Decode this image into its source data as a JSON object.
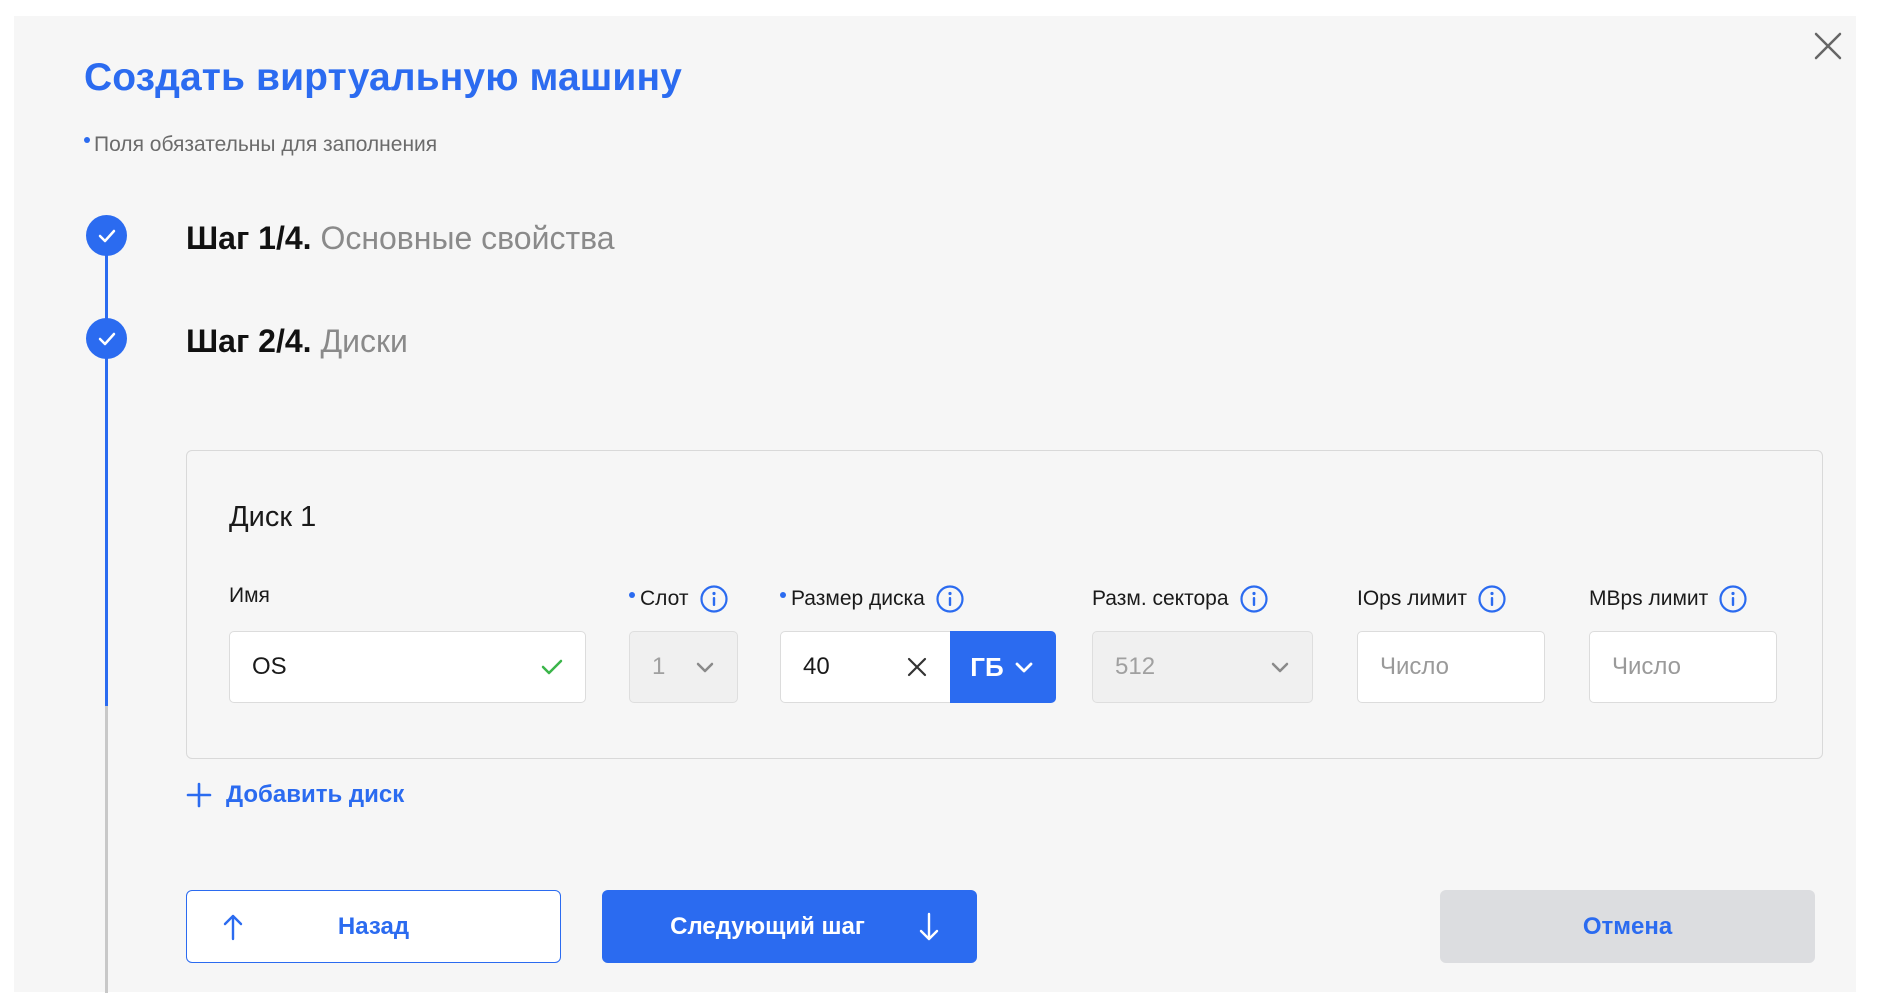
{
  "dialog": {
    "title": "Создать виртуальную машину",
    "required_note": "Поля обязательны для заполнения"
  },
  "steps": [
    {
      "number": "Шаг 1/4.",
      "name": "Основные свойства",
      "completed": true
    },
    {
      "number": "Шаг 2/4.",
      "name": "Диски",
      "completed": true
    }
  ],
  "disk": {
    "title": "Диск 1",
    "fields": {
      "name": {
        "label": "Имя",
        "value": "OS",
        "valid": true
      },
      "slot": {
        "label": "Слот",
        "value": "1",
        "required": true
      },
      "size": {
        "label": "Размер диска",
        "value": "40",
        "unit": "ГБ",
        "required": true
      },
      "sector": {
        "label": "Разм. сектора",
        "value": "512"
      },
      "iops": {
        "label": "IOps лимит",
        "placeholder": "Число"
      },
      "mbps": {
        "label": "MBps лимит",
        "placeholder": "Число"
      }
    }
  },
  "actions": {
    "add_disk": "Добавить диск",
    "back": "Назад",
    "next": "Следующий шаг",
    "cancel": "Отмена"
  },
  "colors": {
    "accent": "#2b6bf0",
    "valid_check": "#3bb54a",
    "panel_bg": "#f6f6f6"
  },
  "icons": {
    "close": "close-icon",
    "step_done": "check-icon",
    "info": "info-icon",
    "dropdown": "chevron-down-icon",
    "clear": "clear-icon",
    "add": "plus-icon",
    "back": "arrow-up-icon",
    "next": "arrow-down-icon"
  }
}
